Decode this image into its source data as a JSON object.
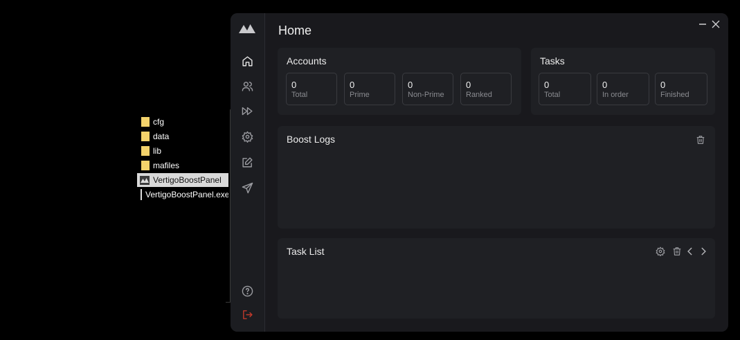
{
  "explorer": {
    "items": [
      {
        "name": "cfg",
        "type": "folder"
      },
      {
        "name": "data",
        "type": "folder"
      },
      {
        "name": "lib",
        "type": "folder"
      },
      {
        "name": "mafiles",
        "type": "folder"
      },
      {
        "name": "VertigoBoostPanel",
        "type": "app",
        "selected": true
      },
      {
        "name": "VertigoBoostPanel.exe.config",
        "type": "config"
      }
    ]
  },
  "app": {
    "title": "Home",
    "sidebar": {
      "items": [
        "home-icon",
        "users-icon",
        "fast-forward-icon",
        "settings-icon",
        "edit-icon",
        "send-icon"
      ],
      "bottom": [
        "help-icon",
        "logout-icon"
      ],
      "logout_color": "#c0392b"
    },
    "accounts": {
      "title": "Accounts",
      "stats": [
        {
          "value": "0",
          "label": "Total"
        },
        {
          "value": "0",
          "label": "Prime"
        },
        {
          "value": "0",
          "label": "Non-Prime"
        },
        {
          "value": "0",
          "label": "Ranked"
        }
      ]
    },
    "tasks": {
      "title": "Tasks",
      "stats": [
        {
          "value": "0",
          "label": "Total"
        },
        {
          "value": "0",
          "label": "In order"
        },
        {
          "value": "0",
          "label": "Finished"
        }
      ]
    },
    "boost_logs": {
      "title": "Boost Logs"
    },
    "task_list": {
      "title": "Task List"
    }
  }
}
